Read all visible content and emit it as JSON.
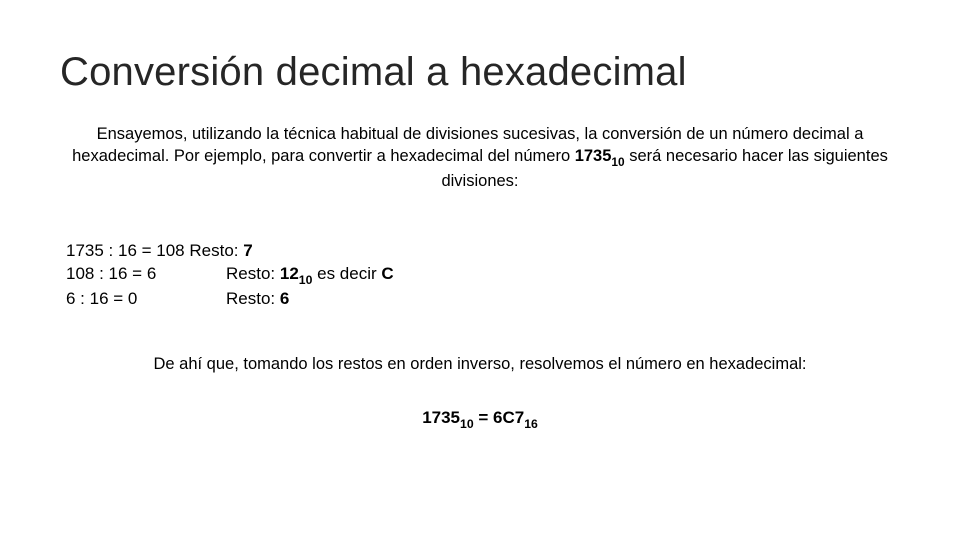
{
  "title": "Conversión decimal a hexadecimal",
  "intro": {
    "p1": "Ensayemos, utilizando la técnica habitual de divisiones sucesivas, la conversión de un número decimal a hexadecimal. Por ejemplo, para convertir a hexadecimal del número ",
    "num": "1735",
    "numSub": "10",
    "p2": " será necesario hacer las siguientes divisiones:"
  },
  "calc": {
    "r1": {
      "eq": "1735 : 16 = 108",
      "rest": " Resto: ",
      "val": "7"
    },
    "r2": {
      "eq": "108 : 16 = 6",
      "rest": "Resto: ",
      "val": "12",
      "valSub": "10",
      "mid": " es decir ",
      "letter": "C"
    },
    "r3": {
      "eq": "6 : 16 = 0",
      "rest": "Resto: ",
      "val": "6"
    }
  },
  "conclusion": "De ahí que, tomando los restos en orden inverso, resolvemos el número en hexadecimal:",
  "final": {
    "lhs": "1735",
    "lhsSub": "10",
    "eq": " = ",
    "rhs": "6C7",
    "rhsSub": "16"
  }
}
